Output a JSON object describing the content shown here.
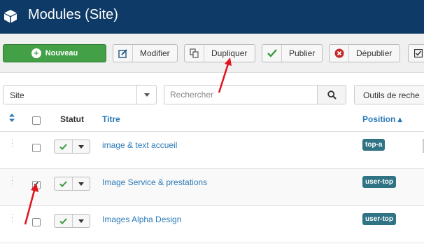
{
  "header": {
    "title": "Modules (Site)",
    "icon": "cube-icon"
  },
  "toolbar": {
    "new_label": "Nouveau",
    "edit_label": "Modifier",
    "duplicate_label": "Dupliquer",
    "publish_label": "Publier",
    "unpublish_label": "Dépublier"
  },
  "filters": {
    "site_select_value": "Site",
    "search_placeholder": "Rechercher",
    "tools_label": "Outils de reche"
  },
  "table": {
    "columns": {
      "status": "Statut",
      "title": "Titre",
      "position": "Position ▴"
    },
    "rows": [
      {
        "title": "image & text accueil",
        "position": "top-a",
        "checked": false,
        "status": "published"
      },
      {
        "title": "Image Service & prestations",
        "position": "user-top",
        "checked": true,
        "status": "published"
      },
      {
        "title": "Images Alpha Design",
        "position": "user-top",
        "checked": false,
        "status": "published"
      }
    ]
  },
  "colors": {
    "header_bg": "#0d3a66",
    "new_button": "#43a047",
    "link": "#2b7ab8",
    "badge": "#2f7385",
    "annotation_arrow": "#e0141e"
  }
}
